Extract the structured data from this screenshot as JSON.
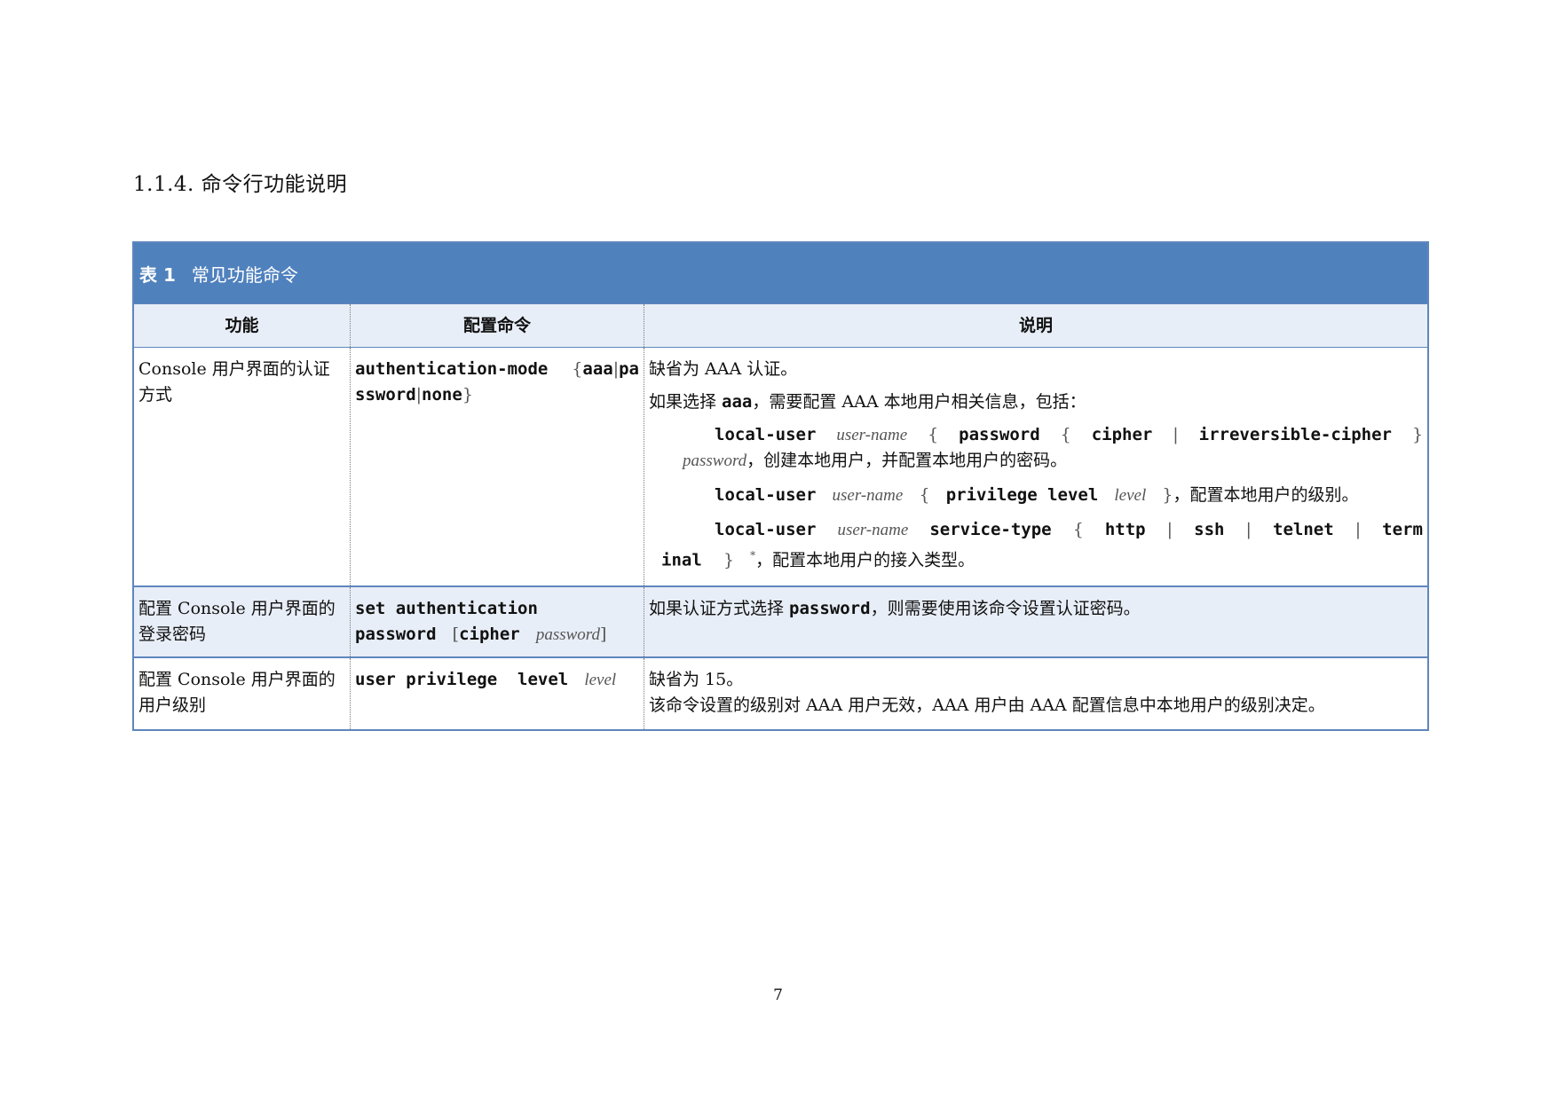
{
  "section": {
    "title": "1.1.4.  命令行功能说明"
  },
  "table": {
    "caption_number": "表 1",
    "caption_title": "常见功能命令",
    "headers": [
      "功能",
      "配置命令",
      "说明"
    ],
    "row1": {
      "function": "Console 用户界面的认证方式",
      "command": {
        "keyword": "authentication-mode",
        "open": "{",
        "opt1": "aaa",
        "sep": "|",
        "opt2_a": "pa",
        "opt2_b": "ssword",
        "opt3": "none",
        "close": "}"
      },
      "desc_p1": "缺省为 AAA 认证。",
      "desc_p2_pre": "如果选择 ",
      "desc_p2_kw": "aaa",
      "desc_p2_post": "，需要配置 AAA 本地用户相关信息，包括：",
      "line1": {
        "kw1": "local-user",
        "arg1": "user-name",
        "open": "{",
        "kw2": "password",
        "open2": "{",
        "kw3": "cipher",
        "bar": "|",
        "kw4": "irreversible-cipher",
        "close": "}",
        "arg2": "password",
        "text": "，创建本地用户，并配置本地用户的密码。"
      },
      "line2": {
        "kw1": "local-user",
        "arg1": "user-name",
        "open": "{",
        "kw2": "privilege level",
        "arg2": "level",
        "close": "}",
        "text": "，配置本地用户的级别。"
      },
      "line3": {
        "kw1": "local-user",
        "arg1": "user-name",
        "kw2": "service-type",
        "open": "{",
        "kw3": "http",
        "bar": "|",
        "kw4": "ssh",
        "kw5": "telnet",
        "kw6a": "term",
        "kw6b": "inal",
        "close": "}",
        "star": "*",
        "text": "，配置本地用户的接入类型。"
      }
    },
    "row2": {
      "function": "配置 Console 用户界面的登录密码",
      "command": {
        "kw1": "set authentication",
        "kw2": "password",
        "open": "[",
        "kw3": "cipher",
        "arg": "password",
        "close": "]"
      },
      "desc_pre": "如果认证方式选择 ",
      "desc_kw": "password",
      "desc_post": "，则需要使用该命令设置认证密码。"
    },
    "row3": {
      "function": "配置 Console 用户界面的用户级别",
      "command": {
        "kw": "user privilege  level",
        "arg": "level"
      },
      "desc_p1": "缺省为 15。",
      "desc_p2": "该命令设置的级别对 AAA 用户无效，AAA 用户由 AAA 配置信息中本地用户的级别决定。"
    }
  },
  "page_number": "7"
}
